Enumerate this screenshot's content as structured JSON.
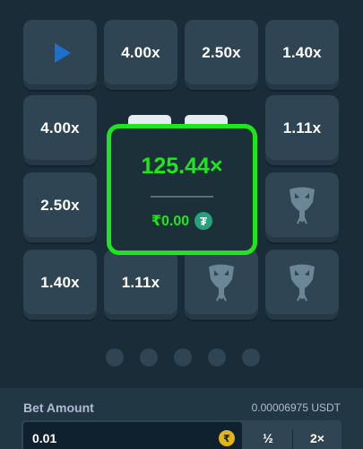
{
  "board": {
    "row1": [
      "",
      "4.00x",
      "2.50x",
      "1.40x"
    ],
    "row2": [
      "4.00x",
      "",
      "",
      "1.11x"
    ],
    "row3": [
      "2.50x",
      "",
      "",
      ""
    ],
    "row4": [
      "1.40x",
      "1.11x",
      "",
      ""
    ]
  },
  "result": {
    "multiplier": "125.44×",
    "payout": "₹0.00",
    "currency_icon": "tether-icon",
    "color": "#1fe51f"
  },
  "pagination": {
    "count": 5
  },
  "bet": {
    "label": "Bet Amount",
    "usdt_value": "0.00006975 USDT",
    "input_value": "0.01",
    "coin_symbol": "₹",
    "half_label": "½",
    "double_label": "2×"
  }
}
